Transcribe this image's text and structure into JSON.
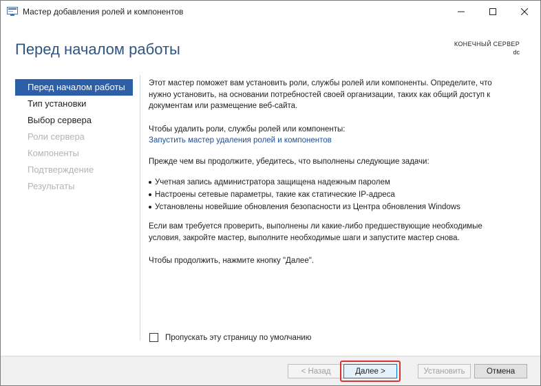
{
  "window": {
    "title": "Мастер добавления ролей и компонентов",
    "controls": {
      "minimize": "—",
      "maximize": "☐",
      "close": "✕"
    }
  },
  "header": {
    "title": "Перед началом работы",
    "server_label": "КОНЕЧНЫЙ СЕРВЕР",
    "server_name": "dc"
  },
  "nav": {
    "items": [
      {
        "label": "Перед началом работы",
        "state": "active"
      },
      {
        "label": "Тип установки",
        "state": "enabled"
      },
      {
        "label": "Выбор сервера",
        "state": "enabled"
      },
      {
        "label": "Роли сервера",
        "state": "disabled"
      },
      {
        "label": "Компоненты",
        "state": "disabled"
      },
      {
        "label": "Подтверждение",
        "state": "disabled"
      },
      {
        "label": "Результаты",
        "state": "disabled"
      }
    ]
  },
  "content": {
    "intro": "Этот мастер поможет вам установить роли, службы ролей или компоненты. Определите, что нужно установить, на основании потребностей своей организации, таких как общий доступ к документам или размещение веб-сайта.",
    "remove_text": "Чтобы удалить роли, службы ролей или компоненты:",
    "remove_link": "Запустить мастер удаления ролей и компонентов",
    "before_text": "Прежде чем вы продолжите, убедитесь, что выполнены следующие задачи:",
    "bullets": [
      "Учетная запись администратора защищена надежным паролем",
      "Настроены сетевые параметры, такие как статические IP-адреса",
      "Установлены новейшие обновления безопасности из Центра обновления Windows"
    ],
    "prereq_text": "Если вам требуется проверить, выполнены ли какие-либо предшествующие необходимые условия, закройте мастер, выполните необходимые шаги и запустите мастер снова.",
    "continue_text": "Чтобы продолжить, нажмите кнопку \"Далее\"."
  },
  "skip": {
    "label": "Пропускать эту страницу по умолчанию",
    "checked": false
  },
  "footer": {
    "back_label": "< Назад",
    "next_label": "Далее >",
    "install_label": "Установить",
    "cancel_label": "Отмена"
  },
  "colors": {
    "accent": "#2c5fa8",
    "title": "#305480",
    "link": "#1d4f99",
    "highlight": "#d93030"
  }
}
